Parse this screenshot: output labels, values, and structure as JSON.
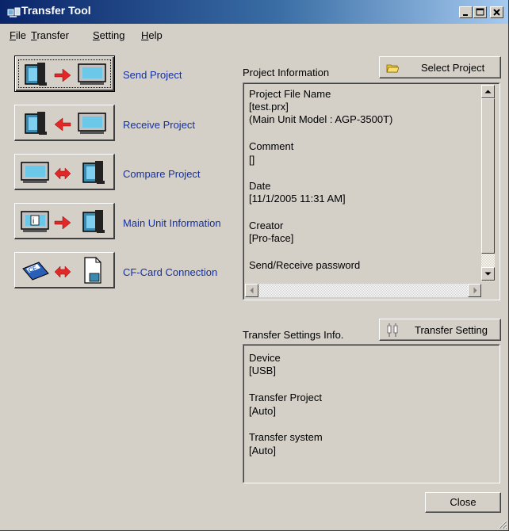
{
  "window": {
    "title": "Transfer Tool"
  },
  "menu": [
    {
      "label": "File",
      "accel": "F",
      "rest": "ile"
    },
    {
      "label": "Transfer",
      "accel": "T",
      "rest": "ransfer"
    },
    {
      "label": "Setting",
      "accel": "S",
      "rest": "etting"
    },
    {
      "label": "Help",
      "accel": "H",
      "rest": "elp"
    }
  ],
  "actions": [
    {
      "label": "Send Project",
      "icon": "pc-to-display-arrow-icon"
    },
    {
      "label": "Receive Project",
      "icon": "display-to-pc-arrow-icon"
    },
    {
      "label": "Compare Project",
      "icon": "compare-arrows-icon"
    },
    {
      "label": "Main Unit Information",
      "icon": "unit-info-icon"
    },
    {
      "label": "CF-Card Connection",
      "icon": "cf-card-icon"
    }
  ],
  "project_info": {
    "section_label": "Project Information",
    "select_button": "Select Project",
    "lines": [
      "Project File Name",
      "[test.prx]",
      "(Main Unit Model : AGP-3500T)",
      "",
      "Comment",
      "[]",
      "",
      "Date",
      "[11/1/2005 11:31 AM]",
      "",
      "Creator",
      "[Pro-face]",
      "",
      "Send/Receive password"
    ]
  },
  "transfer_info": {
    "section_label": "Transfer Settings Info.",
    "settings_button": "Transfer Setting",
    "lines": [
      "Device",
      "[USB]",
      "",
      "Transfer Project",
      "[Auto]",
      "",
      "Transfer system",
      "[Auto]"
    ]
  },
  "footer": {
    "close_button": "Close"
  },
  "colors": {
    "title_start": "#0a246a",
    "title_end": "#a6caf0",
    "link_blue": "#1530a0",
    "face": "#d4d0c8"
  }
}
